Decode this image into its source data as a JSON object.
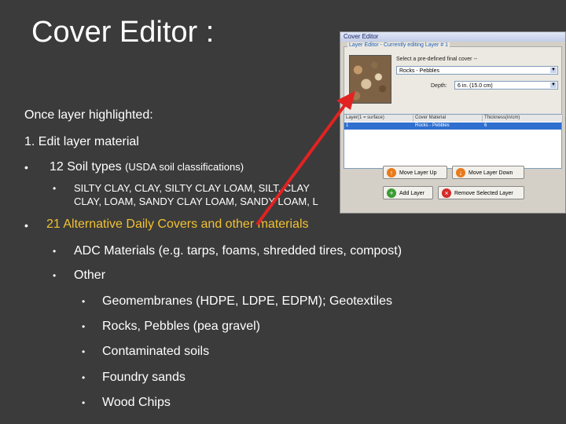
{
  "slide": {
    "title": "Cover Editor :",
    "intro": "Once layer highlighted:",
    "step1": "1.  Edit layer material",
    "bullet_char": "•",
    "soil": {
      "heading": "12 Soil types",
      "note": "(USDA soil classifications)",
      "list_line1": "SILTY CLAY,  CLAY, SILTY CLAY LOAM, SILT, CLAY",
      "list_line2": "CLAY, LOAM,  SANDY CLAY LOAM, SANDY LOAM, L"
    },
    "adc": {
      "heading": "21 Alternative Daily Covers and other materials",
      "items": [
        "ADC Materials  (e.g. tarps, foams, shredded tires, compost)",
        "Other"
      ],
      "other_items": [
        "Geomembranes (HDPE, LDPE, EDPM); Geotextiles",
        "Rocks, Pebbles (pea gravel)",
        "Contaminated soils",
        "Foundry sands",
        "Wood Chips"
      ]
    },
    "colors": {
      "background": "#3b3b3b",
      "accent_yellow": "#f1c232",
      "arrow": "#e32222"
    }
  },
  "dialog": {
    "title": "Cover Editor",
    "group_label": "Layer Editor - Currently editing Layer # 1",
    "select_prompt": "Select a pre-defined final cover --",
    "material_value": "Rocks - Pebbles",
    "depth_label": "Depth:",
    "depth_value": "6 in. (15.0 cm)",
    "table_headers": [
      "Layer(1 = surface)",
      "Cover Material",
      "Thickness(in/cm)"
    ],
    "table_row": [
      "1",
      "Rocks - Pebbles",
      "6"
    ],
    "buttons": {
      "move_up": "Move Layer Up",
      "move_down": "Move Layer Down",
      "add": "Add Layer",
      "remove": "Remove Selected Layer"
    }
  }
}
